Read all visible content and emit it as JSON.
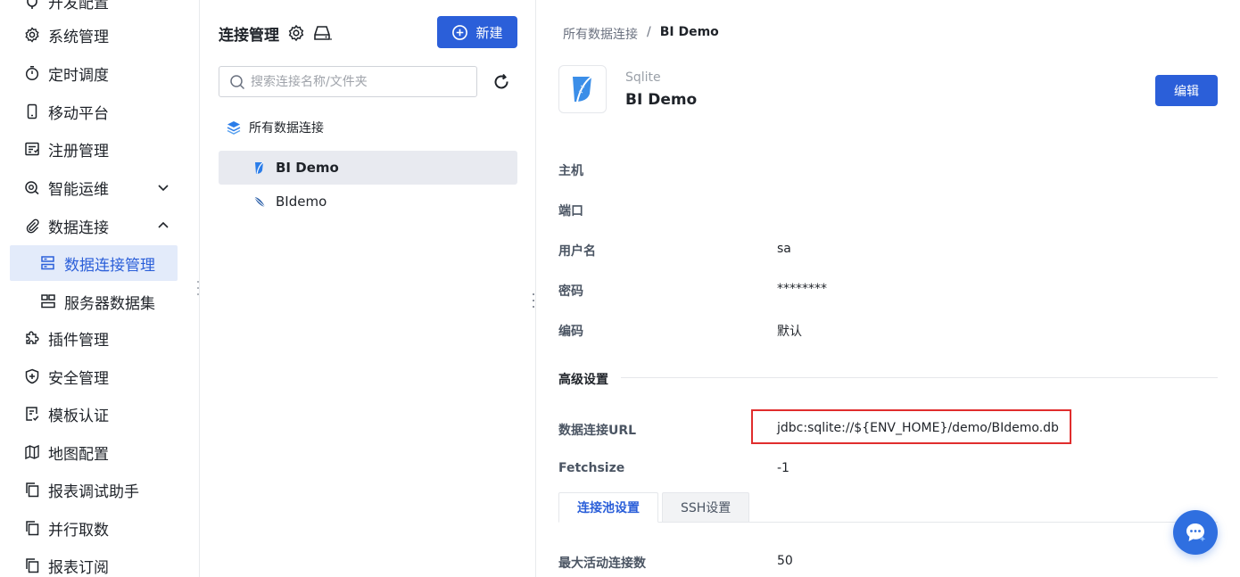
{
  "nav": {
    "items": [
      {
        "label": "开发配置",
        "icon": "plug-icon"
      },
      {
        "label": "系统管理",
        "icon": "gear-icon"
      },
      {
        "label": "定时调度",
        "icon": "stopwatch-icon"
      },
      {
        "label": "移动平台",
        "icon": "mobile-icon"
      },
      {
        "label": "注册管理",
        "icon": "register-icon"
      },
      {
        "label": "智能运维",
        "icon": "monitor-icon"
      },
      {
        "label": "数据连接",
        "icon": "paperclip-icon"
      },
      {
        "label": "数据连接管理",
        "icon": "datasource-icon"
      },
      {
        "label": "服务器数据集",
        "icon": "dataset-icon"
      },
      {
        "label": "插件管理",
        "icon": "puzzle-icon"
      },
      {
        "label": "安全管理",
        "icon": "shield-icon"
      },
      {
        "label": "模板认证",
        "icon": "template-icon"
      },
      {
        "label": "地图配置",
        "icon": "map-icon"
      },
      {
        "label": "报表调试助手",
        "icon": "copy-icon"
      },
      {
        "label": "并行取数",
        "icon": "copy-icon"
      },
      {
        "label": "报表订阅",
        "icon": "copy-icon"
      }
    ]
  },
  "mid": {
    "title": "连接管理",
    "new_label": "新建",
    "search_placeholder": "搜索连接名称/文件夹",
    "root_label": "所有数据连接",
    "items": [
      {
        "label": "BI Demo",
        "icon": "sqlite-feather-icon"
      },
      {
        "label": "BIdemo",
        "icon": "sqlite-feather-icon"
      }
    ]
  },
  "detail": {
    "breadcrumb_root": "所有数据连接",
    "breadcrumb_sep": "/",
    "breadcrumb_current": "BI Demo",
    "db_type": "Sqlite",
    "db_name": "BI Demo",
    "edit_label": "编辑",
    "fields": {
      "host_label": "主机",
      "host_value": "",
      "port_label": "端口",
      "port_value": "",
      "user_label": "用户名",
      "user_value": "sa",
      "password_label": "密码",
      "password_value": "********",
      "encoding_label": "编码",
      "encoding_value": "默认"
    },
    "advanced_title": "高级设置",
    "url_label": "数据连接URL",
    "url_value": "jdbc:sqlite://${ENV_HOME}/demo/BIdemo.db",
    "fetchsize_label": "Fetchsize",
    "fetchsize_value": "-1",
    "tabs": [
      "连接池设置",
      "SSH设置"
    ],
    "max_active_label": "最大活动连接数",
    "max_active_value": "50"
  },
  "colors": {
    "primary": "#2b5fd9",
    "active_nav_bg": "#e3ebfa",
    "highlight_border": "#e02d2d"
  }
}
